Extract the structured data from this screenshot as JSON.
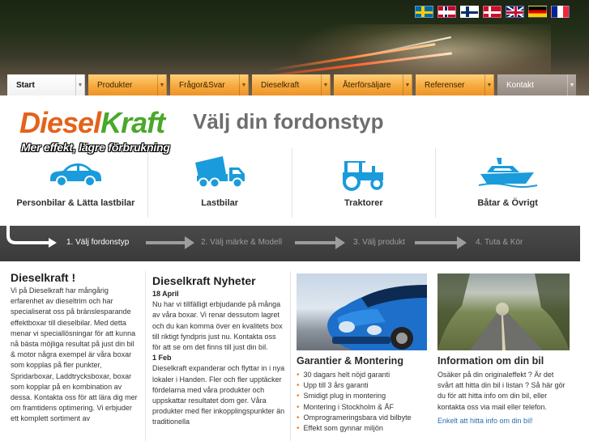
{
  "nav": {
    "tabs": [
      {
        "label": "Start"
      },
      {
        "label": "Produkter"
      },
      {
        "label": "Frågor&Svar"
      },
      {
        "label": "Dieselkraft"
      },
      {
        "label": "Återförsäljare"
      },
      {
        "label": "Referenser"
      },
      {
        "label": "Kontakt"
      }
    ]
  },
  "flags": [
    "sweden-flag-icon",
    "norway-flag-icon",
    "finland-flag-icon",
    "denmark-flag-icon",
    "uk-flag-icon",
    "germany-flag-icon",
    "france-flag-icon"
  ],
  "logo": {
    "word1": "Diesel",
    "word2": "Kraft",
    "tagline": "Mer effekt, lägre förbrukning"
  },
  "page_title": "Välj din fordonstyp",
  "vehicles": [
    {
      "label": "Personbilar & Lätta lastbilar",
      "icon": "car-icon"
    },
    {
      "label": "Lastbilar",
      "icon": "dump-truck-icon"
    },
    {
      "label": "Traktorer",
      "icon": "tractor-icon"
    },
    {
      "label": "Båtar & Övrigt",
      "icon": "boat-icon"
    }
  ],
  "steps": [
    "1. Välj fordonstyp",
    "2. Välj märke & Modell",
    "3. Välj produkt",
    "4. Tuta & Kör"
  ],
  "col1": {
    "title": "Dieselkraft !",
    "text": "Vi på Dieselkraft har mångårig erfarenhet av dieseltrim och har specialiserat oss på bränslesparande effektboxar till dieselbilar. Med detta menar vi speciallösningar för att kunna nå bästa möjliga resultat på just din bil & motor några exempel är våra boxar som kopplas på fler punkter, Spridarboxar, Laddtrycksboxar, boxar som kopplar på en kombination av dessa. Kontakta oss för att lära dig mer om framtidens optimering. Vi erbjuder ett komplett sortiment av"
  },
  "col2": {
    "title": "Dieselkraft Nyheter",
    "news": [
      {
        "date": "18 April",
        "text": "Nu har vi tillfälligt erbjudande på många av våra boxar. Vi renar dessutom lagret och du kan komma över en kvalitets box till riktigt fyndpris just nu. Kontakta oss för att se om det finns till just din bil."
      },
      {
        "date": "1 Feb",
        "text": "Dieselkraft expanderar och flyttar in i nya lokaler i Handen. Fler och fler upptäcker fördelarna med våra produkter och uppskattar resultatet dom ger. Våra produkter med fler inkopplingspunkter än traditionella"
      }
    ]
  },
  "col3": {
    "title": "Garantier & Montering",
    "items": [
      "30 dagars helt nöjd garanti",
      "Upp till 3 års garanti",
      "Smidigt plug in montering",
      "Montering i Stockholm & ÅF",
      "Omprogrameringsbara vid bilbyte",
      "Effekt som gynnar miljön"
    ]
  },
  "col4": {
    "title": "Information om din bil",
    "text": "Osäker på din originaleffekt ? Är det svårt att hitta din bil i listan ? Så här gör du för att hitta info om din bil, eller kontakta oss via mail eller telefon.",
    "link": "Enkelt att hitta info om din bil!"
  },
  "colors": {
    "accent_orange": "#f6a93e",
    "logo_orange": "#e4621b",
    "logo_green": "#4aa82b",
    "step_bar": "#404040",
    "link": "#2a6db5",
    "icon_blue": "#1a9bdb"
  }
}
